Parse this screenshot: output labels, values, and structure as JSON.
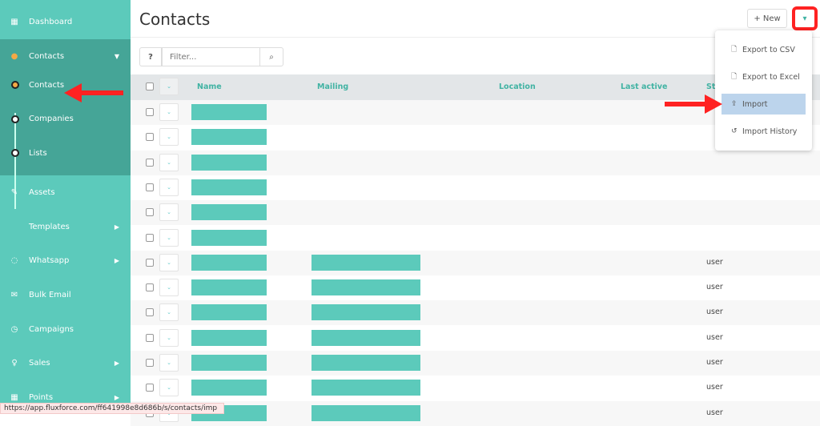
{
  "sidebar": {
    "items": [
      {
        "label": "Dashboard",
        "icon": "grid-icon",
        "glyph": "▦"
      },
      {
        "label": "Contacts",
        "icon": "user-icon",
        "glyph": "●"
      },
      {
        "label": "Assets",
        "icon": "paperclip-icon",
        "glyph": "✎"
      },
      {
        "label": "Templates",
        "icon": "code-icon",
        "glyph": "</>"
      },
      {
        "label": "Whatsapp",
        "icon": "whatsapp-icon",
        "glyph": "◌"
      },
      {
        "label": "Bulk Email",
        "icon": "envelope-icon",
        "glyph": "✉"
      },
      {
        "label": "Campaigns",
        "icon": "clock-icon",
        "glyph": "◷"
      },
      {
        "label": "Sales",
        "icon": "lightbulb-icon",
        "glyph": "♀"
      },
      {
        "label": "Points",
        "icon": "calculator-icon",
        "glyph": "▦"
      }
    ],
    "sub": [
      "Contacts",
      "Companies",
      "Lists"
    ]
  },
  "header": {
    "title": "Contacts",
    "new_label": "+ New"
  },
  "filter": {
    "placeholder": "Filter...",
    "help": "?",
    "search": "⌕"
  },
  "table": {
    "columns": [
      "Name",
      "Mailing",
      "Location",
      "Last active",
      "Sta"
    ],
    "status_value": "user",
    "row_count": 13,
    "rows_with_status_from": 6
  },
  "menu": {
    "items": [
      {
        "label": "Export to CSV",
        "icon": "file-icon",
        "glyph": "🗋"
      },
      {
        "label": "Export to Excel",
        "icon": "file-excel-icon",
        "glyph": "🗋"
      },
      {
        "label": "Import",
        "icon": "upload-icon",
        "glyph": "⇪"
      },
      {
        "label": "Import History",
        "icon": "history-icon",
        "glyph": "↺"
      }
    ]
  },
  "status_bar": "https://app.fluxforce.com/ff641998e8d686b/s/contacts/imp",
  "colors": {
    "sidebar": "#5ccabb",
    "sidebar_active": "#45a597",
    "accent": "#41b3a3",
    "highlight": "#bcd4ec",
    "annotation": "#ff2a1a"
  }
}
